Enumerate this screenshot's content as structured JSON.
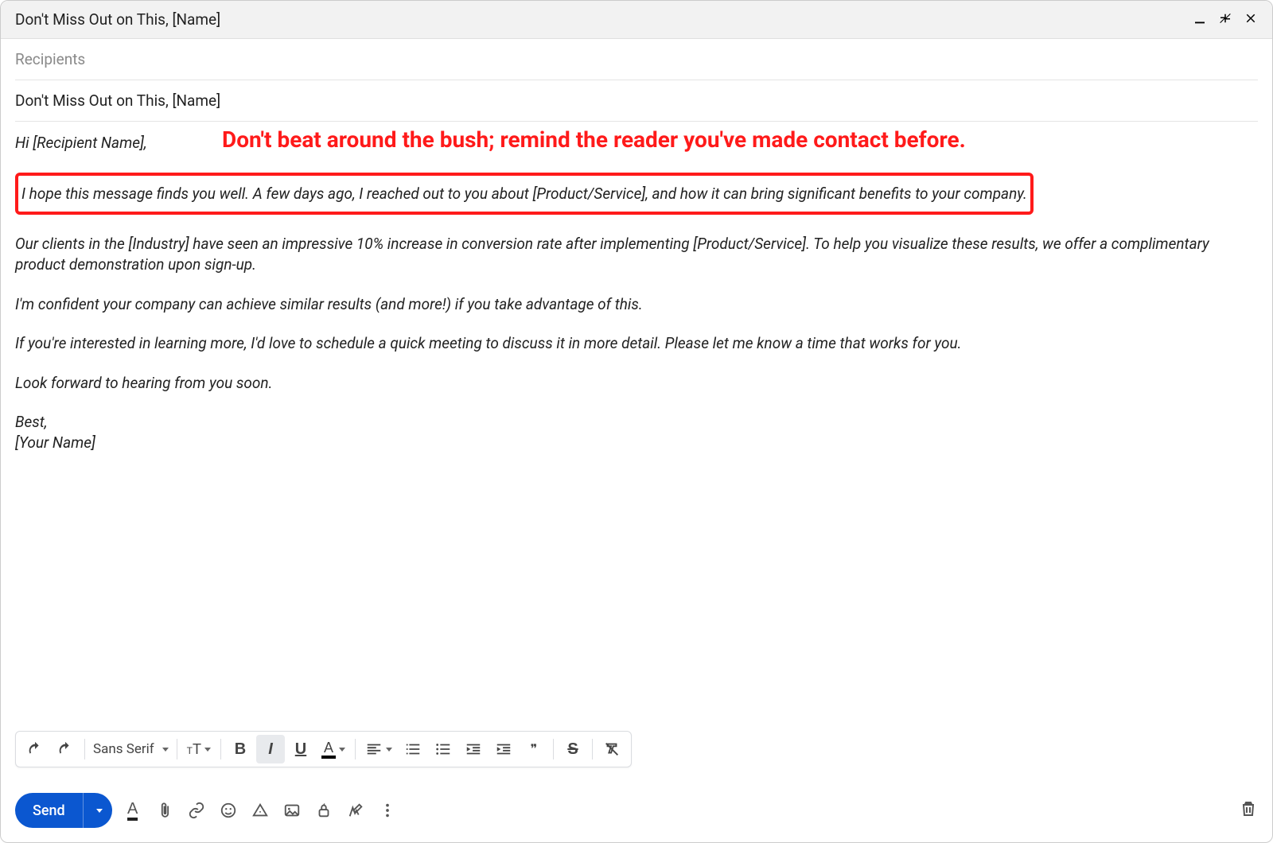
{
  "titlebar": {
    "title": "Don't Miss Out on This, [Name]"
  },
  "fields": {
    "recipients_placeholder": "Recipients",
    "subject": "Don't Miss Out on This, [Name]"
  },
  "annotation": "Don't beat around the bush; remind the reader you've made contact before.",
  "body": {
    "greeting": "Hi [Recipient Name],",
    "highlighted": "I hope this message finds you well. A few days ago, I reached out to you about [Product/Service], and how it can bring significant benefits to your company.",
    "p2": "Our clients in the [Industry] have seen an impressive 10% increase in conversion rate after implementing [Product/Service]. To help you visualize these results, we offer a complimentary product demonstration upon sign-up.",
    "p3": "I'm confident your company can achieve similar results (and more!) if you take advantage of this.",
    "p4": "If you're interested in learning more, I'd love to schedule a quick meeting to discuss it in more detail. Please let me know a time that works for you.",
    "p5": "Look forward to hearing from you soon.",
    "signoff": "Best,",
    "signature": "[Your Name]"
  },
  "format_toolbar": {
    "font": "Sans Serif",
    "bold": "B",
    "italic": "I",
    "underline": "U",
    "textcolor": "A",
    "quote": "❞",
    "strike": "S"
  },
  "bottom": {
    "send": "Send"
  }
}
